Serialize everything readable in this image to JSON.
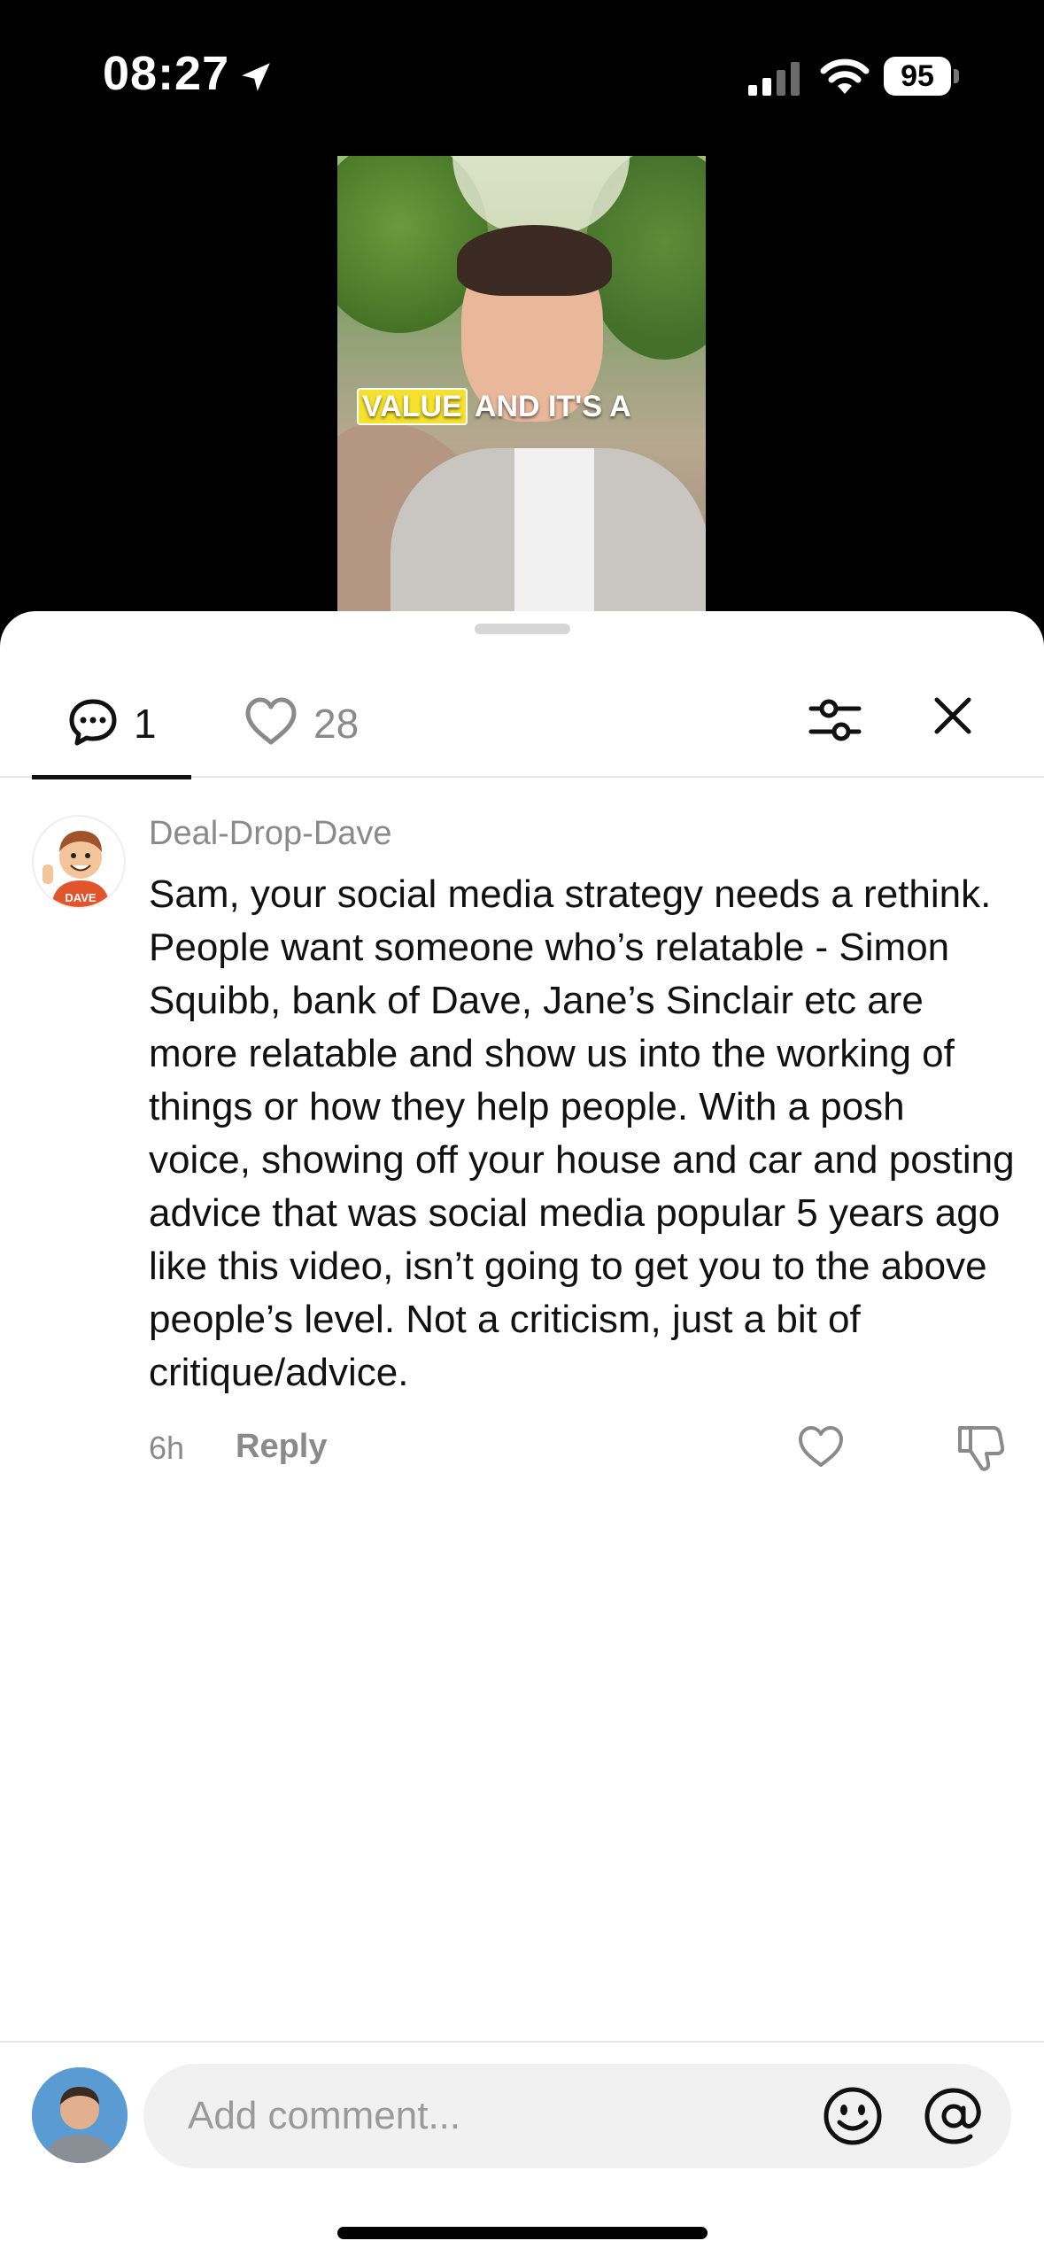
{
  "status_bar": {
    "time": "08:27",
    "battery": "95"
  },
  "video": {
    "caption_highlight": "VALUE",
    "caption_rest": "AND IT'S A"
  },
  "tabs": {
    "comments_count": "1",
    "likes_count": "28"
  },
  "comment": {
    "username": "Deal-Drop-Dave",
    "avatar_badge": "DAVE",
    "text": "Sam, your social media strategy needs a rethink. People want someone who’s relatable - Simon Squibb, bank of Dave, Jane’s Sinclair etc are more relatable and show us into the working of things or how they help people. With a posh voice, showing off your house and car and posting advice that was social media popular 5 years ago like this video, isn’t going to get you to the above people’s level. Not a criticism, just a bit of critique/advice.",
    "time": "6h",
    "reply_label": "Reply"
  },
  "composer": {
    "placeholder": "Add comment..."
  },
  "icons": {
    "location": "location-arrow-icon",
    "signal": "cellular-signal-icon",
    "wifi": "wifi-icon",
    "comments_tab": "speech-bubble-icon",
    "likes_tab": "heart-icon",
    "filter": "sliders-icon",
    "close": "close-icon",
    "like": "heart-icon",
    "dislike": "thumbs-down-icon",
    "emoji": "smiley-icon",
    "mention": "at-sign-icon"
  }
}
